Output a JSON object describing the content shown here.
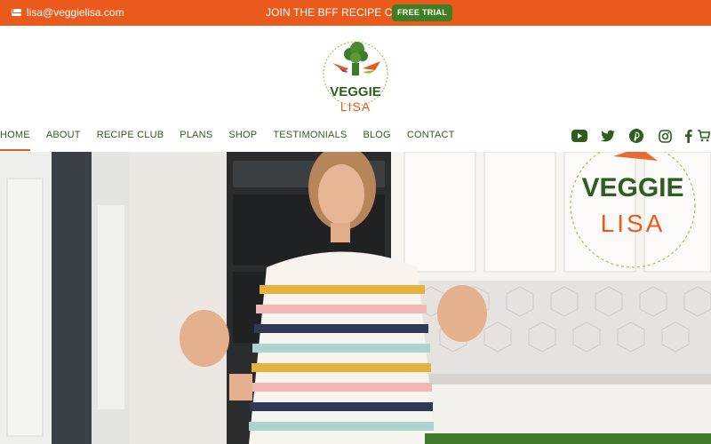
{
  "topbar": {
    "email": "lisa@veggielisa.com",
    "promo": "JOIN THE BFF RECIPE CLUB!",
    "trial_button": "FREE TRIAL"
  },
  "logo": {
    "line1": "VEGGIE",
    "line2": "LISA",
    "icon": "vegetables-logo-icon"
  },
  "nav": {
    "items": [
      "HOME",
      "ABOUT",
      "RECIPE CLUB",
      "PLANS",
      "SHOP",
      "TESTIMONIALS",
      "BLOG",
      "CONTACT"
    ],
    "active": "HOME",
    "social_icons": [
      "youtube-icon",
      "twitter-icon",
      "pinterest-icon",
      "instagram-icon",
      "facebook-icon",
      "cart-icon"
    ]
  },
  "hero": {
    "watermark_line1": "VEGGIE",
    "watermark_line2": "LISA"
  },
  "colors": {
    "accent_orange": "#ea5a1c",
    "brand_green": "#3f7e23",
    "nav_text": "#2d5e1e"
  }
}
